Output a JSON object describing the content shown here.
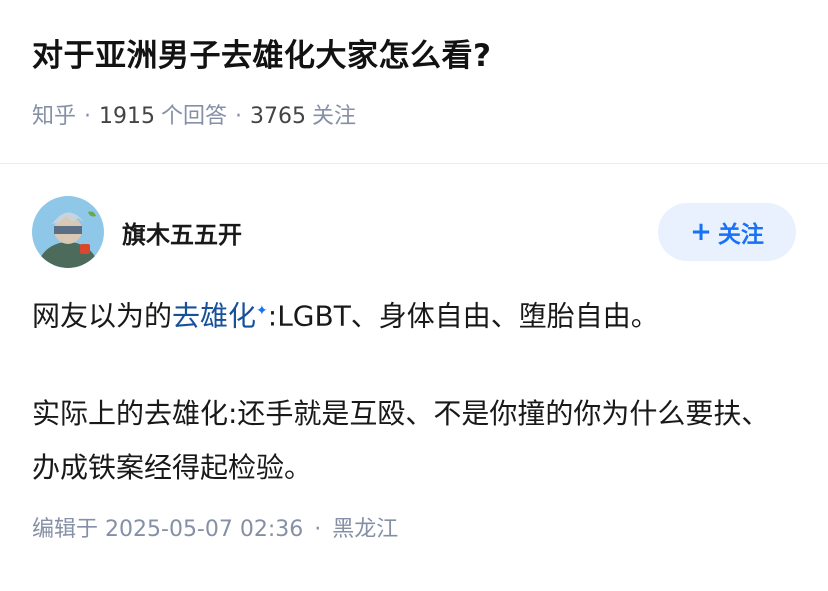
{
  "question": {
    "title": "对于亚洲男子去雄化大家怎么看?",
    "source": "知乎",
    "answer_count": "1915",
    "answer_label": "个回答",
    "follow_count": "3765",
    "follow_label": "关注"
  },
  "answer": {
    "author": "旗木五五开",
    "follow_button": "关注",
    "p1_before": "网友以为的",
    "p1_keyword": "去雄化",
    "p1_after": ":LGBT、身体自由、堕胎自由。",
    "p2": "实际上的去雄化:还手就是互殴、不是你撞的你为什么要扶、办成铁案经得起检验。",
    "edit_label": "编辑于",
    "datetime": "2025-05-07 02:36",
    "location": "黑龙江"
  },
  "colors": {
    "accent": "#1772f6",
    "keyword": "#175199",
    "meta": "#8590a6",
    "button_bg": "#e8f1fd"
  },
  "icons": [
    "plus-icon",
    "sparkle-icon",
    "avatar-image"
  ]
}
